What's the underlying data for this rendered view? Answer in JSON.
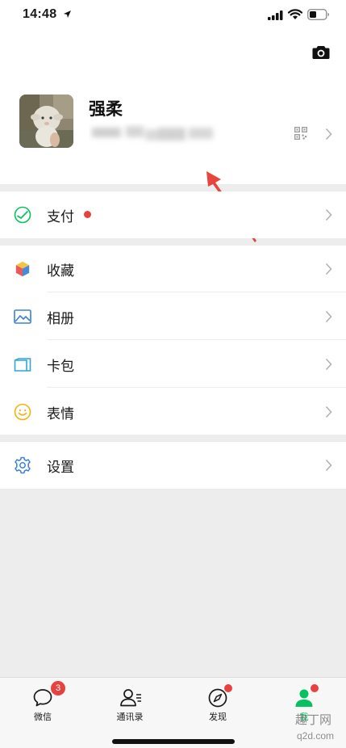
{
  "status_bar": {
    "time": "14:48"
  },
  "profile": {
    "nickname": "强柔"
  },
  "menu": {
    "pay": "支付",
    "favorites": "收藏",
    "album": "相册",
    "cards": "卡包",
    "stickers": "表情",
    "settings": "设置"
  },
  "tabbar": {
    "chats": {
      "label": "微信",
      "badge": "3"
    },
    "contacts": {
      "label": "通讯录"
    },
    "discover": {
      "label": "发现"
    },
    "me": {
      "label": "我"
    }
  },
  "watermark": {
    "line1": "趣丁网",
    "line2": "q2d.com"
  },
  "colors": {
    "accent_green": "#07c160",
    "badge_red": "#e64340",
    "annotation_red": "#e8453c"
  }
}
